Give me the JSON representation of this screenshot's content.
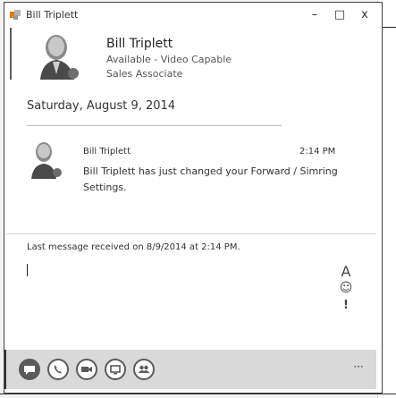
{
  "window": {
    "title": "Bill Triplett",
    "minimize_label": "–",
    "maximize_label": "□",
    "close_label": "x"
  },
  "contact": {
    "name": "Bill Triplett",
    "status": "Available - Video Capable",
    "role": "Sales Associate"
  },
  "conversation": {
    "date_header": "Saturday, August 9, 2014",
    "message": {
      "sender": "Bill Triplett",
      "time": "2:14 PM",
      "text": "Bill Triplett has just changed your Forward / Simring Settings."
    },
    "last_message_note": "Last message received on 8/9/2014 at 2:14 PM."
  },
  "compose": {
    "input_value": "",
    "font_tool_label": "A",
    "emoticon_glyph": "☺",
    "priority_label": "!"
  },
  "toolbar": {
    "more_label": "···",
    "buttons": [
      {
        "icon": "im-icon",
        "style": "filled"
      },
      {
        "icon": "phone-icon",
        "style": "outline"
      },
      {
        "icon": "video-icon",
        "style": "outline"
      },
      {
        "icon": "share-icon",
        "style": "outline"
      },
      {
        "icon": "conference-icon",
        "style": "outline"
      }
    ]
  },
  "colors": {
    "toolbar_bg": "#d9d9d9",
    "icon_gray": "#5a5a5a"
  }
}
